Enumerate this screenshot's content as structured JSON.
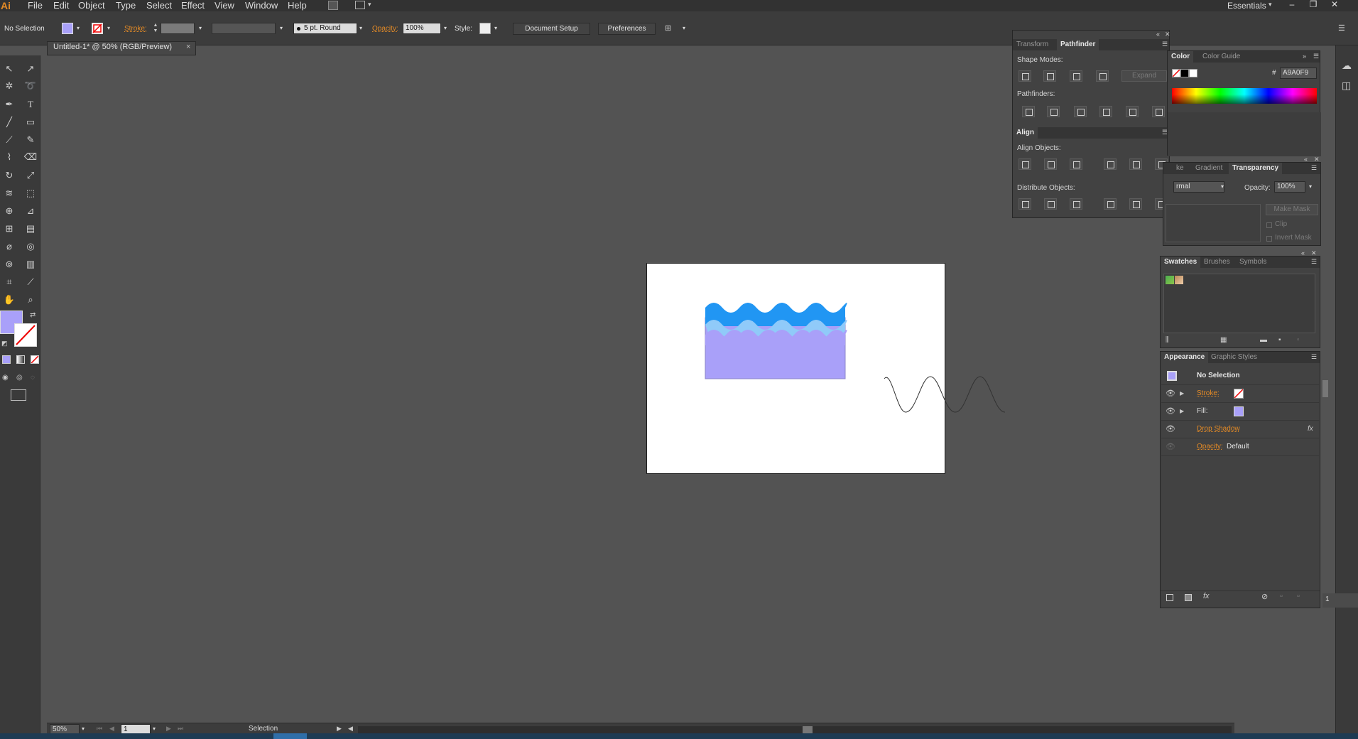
{
  "app": {
    "logo": "Ai",
    "workspace": "Essentials"
  },
  "menu": [
    "File",
    "Edit",
    "Object",
    "Type",
    "Select",
    "Effect",
    "View",
    "Window",
    "Help"
  ],
  "control_bar": {
    "selection_status": "No Selection",
    "stroke_label": "Stroke:",
    "brush_value": "5 pt. Round",
    "opacity_label": "Opacity:",
    "opacity_value": "100%",
    "style_label": "Style:",
    "document_setup": "Document Setup",
    "preferences": "Preferences"
  },
  "document_tab": {
    "title": "Untitled-1* @ 50% (RGB/Preview)",
    "close": "×"
  },
  "pathfinder_panel": {
    "tabs": [
      "Transform",
      "Pathfinder"
    ],
    "active_tab": "Pathfinder",
    "shape_modes_label": "Shape Modes:",
    "expand_label": "Expand",
    "pathfinders_label": "Pathfinders:"
  },
  "align_panel": {
    "title": "Align",
    "align_objects_label": "Align Objects:",
    "distribute_objects_label": "Distribute Objects:"
  },
  "color_panel": {
    "tabs": [
      "Color",
      "Color Guide"
    ],
    "hex_symbol": "#",
    "hex_value": "A9A0F9"
  },
  "transparency_panel": {
    "tabs": [
      "ke",
      "Gradient",
      "Transparency"
    ],
    "blend_mode": "rmal",
    "opacity_label": "Opacity:",
    "opacity_value": "100%",
    "make_mask": "Make Mask",
    "clip": "Clip",
    "invert_mask": "Invert Mask"
  },
  "swatches_panel": {
    "tabs": [
      "Swatches",
      "Brushes",
      "Symbols"
    ]
  },
  "appearance_panel": {
    "tabs": [
      "Appearance",
      "Graphic Styles"
    ],
    "header": "No Selection",
    "stroke_label": "Stroke:",
    "fill_label": "Fill:",
    "drop_shadow": "Drop Shadow",
    "opacity_label": "Opacity:",
    "opacity_value": "Default",
    "fx": "fx"
  },
  "status_bar": {
    "zoom": "50%",
    "page": "1",
    "tool_name": "Selection"
  },
  "right_strip_page": "1",
  "colors": {
    "fill": "#A9A0F9",
    "wave_dark": "#2196F3",
    "wave_light": "#90CAF9",
    "accent_orange": "#E38A26",
    "canvas_bg": "#535353"
  }
}
